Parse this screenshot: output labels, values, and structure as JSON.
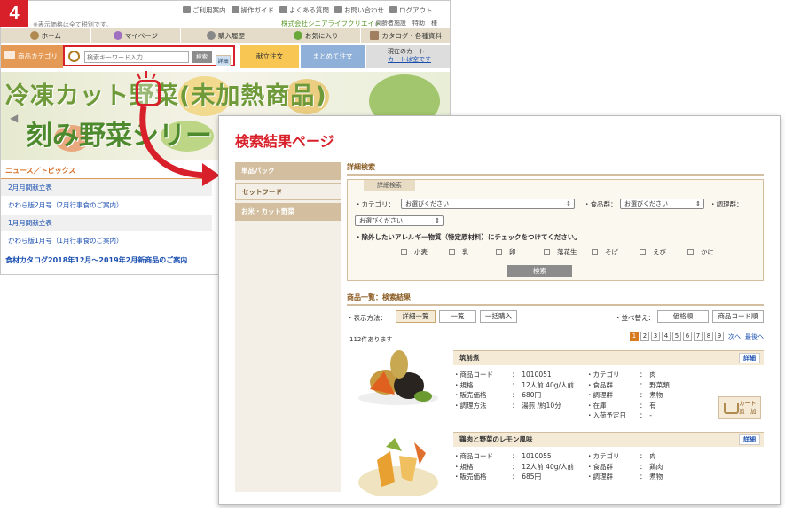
{
  "step": "4",
  "back": {
    "note": "※表示価格は全て税別です。",
    "util": [
      "ご利用案内",
      "操作ガイド",
      "よくある質問",
      "お問い合わせ",
      "ログアウト"
    ],
    "company": "株式会社シニアライフクリエイト",
    "user": "高齢者施設　特助　様",
    "nav": [
      "ホーム",
      "マイページ",
      "購入履歴",
      "お気に入り",
      "カタログ・各種資料"
    ],
    "category": "商品カテゴリ",
    "search_placeholder": "検索キーワード入力",
    "search_button": "検索",
    "advanced": "詳細",
    "order": "献立注文",
    "bulk": "まとめて注文",
    "cart_title": "現在のカート",
    "cart_link": "カートは空です",
    "banner_line1": "冷凍カット野菜(未加熱商品)",
    "banner_line2": "刻み野菜シリー",
    "news_title": "ニュース／トピックス",
    "news": [
      "2月月間献立表",
      "かわら版2月号（2月行事食のご案内）",
      "1月月間献立表",
      "かわら版1月号（1月行事食のご案内）"
    ],
    "news_footer": "食材カタログ2018年12月～2019年2月新商品のご案内"
  },
  "front": {
    "title": "検索結果ページ",
    "side": [
      "単品パック",
      "セットフード",
      "お米・カット野菜"
    ],
    "adv_heading": "詳細検索",
    "adv_tab": "詳細検索",
    "cat_label": "・カテゴリ：",
    "food_label": "・食品群：",
    "cook_label": "・調理群：",
    "select_text": "お選びください",
    "allergy_text": "・除外したいアレルギー物質（特定原材料）にチェックをつけてください。",
    "allergens": [
      "小麦",
      "乳",
      "卵",
      "落花生",
      "そば",
      "えび",
      "かに"
    ],
    "search_btn": "検索",
    "list_heading": "商品一覧：検索結果",
    "display_label": "・表示方法：",
    "display": [
      "詳細一覧",
      "一覧",
      "一括購入"
    ],
    "sort_label": "・並べ替え：",
    "sort": [
      "価格順",
      "商品コード順"
    ],
    "count": "112件あります",
    "pages": [
      "1",
      "2",
      "3",
      "4",
      "5",
      "6",
      "7",
      "8",
      "9"
    ],
    "next": "次へ",
    "last": "最後へ",
    "detail": "詳細",
    "cart_btn": [
      "カート",
      "追　加"
    ],
    "items": [
      {
        "name": "筑前煮",
        "left": [
          [
            "・商品コード",
            "：",
            "1010051"
          ],
          [
            "・規格",
            "：",
            "12人前 40g/人前"
          ],
          [
            "・販売価格",
            "：",
            "680円"
          ],
          [
            "・調理方法",
            "：",
            "湯煎 /約10分"
          ]
        ],
        "right": [
          [
            "・カテゴリ",
            "：",
            "肉"
          ],
          [
            "・食品群",
            "：",
            "野菜類"
          ],
          [
            "・調理群",
            "：",
            "煮物"
          ],
          [
            "・在庫",
            "：",
            "有"
          ],
          [
            "・入荷予定日",
            "：",
            "-"
          ]
        ]
      },
      {
        "name": "鶏肉と野菜のレモン風味",
        "left": [
          [
            "・商品コード",
            "：",
            "1010055"
          ],
          [
            "・規格",
            "：",
            "12人前 40g/人前"
          ],
          [
            "・販売価格",
            "：",
            "685円"
          ]
        ],
        "right": [
          [
            "・カテゴリ",
            "：",
            "肉"
          ],
          [
            "・食品群",
            "：",
            "鶏肉"
          ],
          [
            "・調理群",
            "：",
            "煮物"
          ]
        ]
      }
    ]
  },
  "colors": {
    "accent": "#d8202a",
    "brand_green": "#5a9a2a",
    "tan": "#d3bfa0"
  }
}
